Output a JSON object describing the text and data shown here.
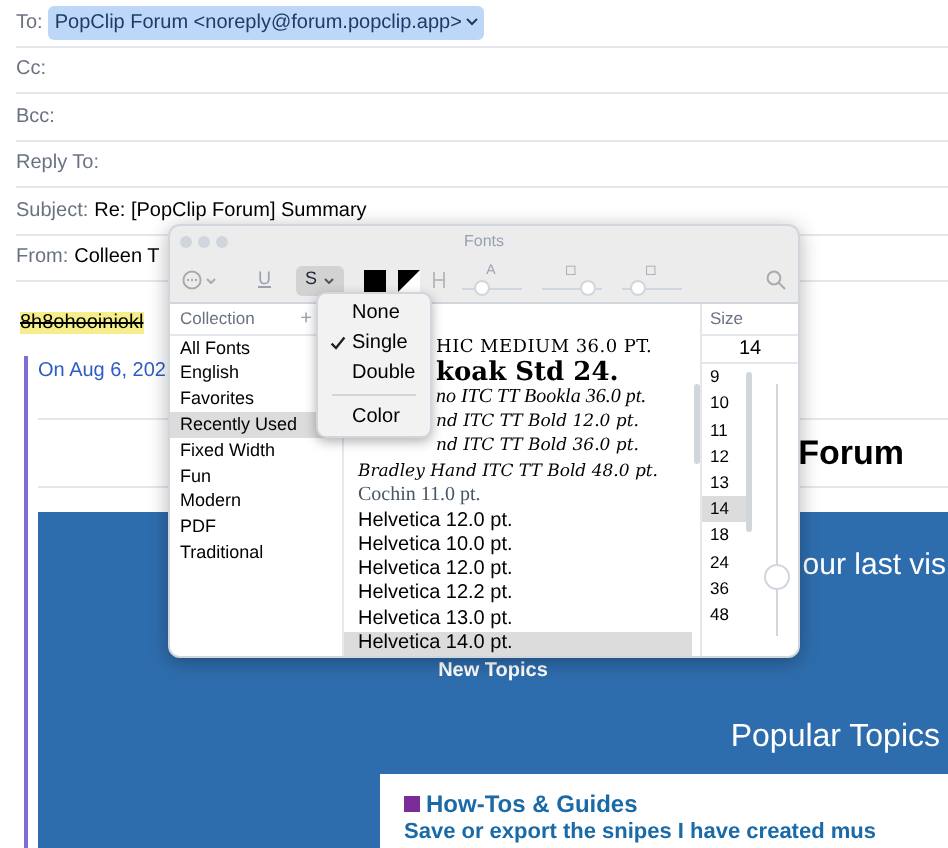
{
  "headers": [
    {
      "label": "To:",
      "value": "PopClip Forum <noreply@forum.popclip.app>",
      "kind": "chip"
    },
    {
      "label": "Cc:",
      "kind": "empty"
    },
    {
      "label": "Bcc:",
      "kind": "empty"
    },
    {
      "label": "Reply To:",
      "kind": "empty"
    },
    {
      "label": "Subject:",
      "value": "Re: [PopClip Forum] Summary",
      "kind": "text"
    },
    {
      "label": "From:",
      "value": "Colleen T",
      "kind": "text"
    }
  ],
  "body": {
    "struck_text": "8h8ohooiniokl",
    "quote_intro": "On Aug 6, 202",
    "forum_title": "Forum",
    "last_visit": "our last vis",
    "new_topics": "New Topics",
    "popular_topics": "Popular Topics",
    "category": "How-Tos & Guides",
    "topic_link": "Save or export the snipes I have created mus"
  },
  "fonts_window": {
    "title": "Fonts",
    "toolbar_sliders": [
      {
        "label": "A",
        "level": 0.3
      },
      {
        "label": "◻",
        "level": 0.9
      },
      {
        "label": "◻",
        "level": 0.2
      }
    ],
    "strike_button": {
      "label": "S",
      "pressed": true
    },
    "underline_button": {
      "label": "U"
    },
    "collection_header": "Collection",
    "add": "+",
    "collections": [
      {
        "label": "All Fonts",
        "selected": false
      },
      {
        "label": "English",
        "selected": false
      },
      {
        "label": "Favorites",
        "selected": false
      },
      {
        "label": "Recently Used",
        "selected": true
      },
      {
        "label": "Fixed Width",
        "selected": false
      },
      {
        "label": "Fun",
        "selected": false
      },
      {
        "label": "Modern",
        "selected": false
      },
      {
        "label": "PDF",
        "selected": false
      },
      {
        "label": "Traditional",
        "selected": false
      }
    ],
    "fonts": [
      {
        "label": "HIC MEDIUM 36.0 PT.",
        "kind": "caps",
        "covered": true,
        "selected": false
      },
      {
        "label": "koak Std 24.",
        "kind": "heavy",
        "covered": true,
        "selected": false
      },
      {
        "label": "no ITC TT Bookla 36.0 pt.",
        "kind": "italic",
        "covered": true,
        "selected": false
      },
      {
        "label": "nd ITC TT Bold 12.0 pt.",
        "kind": "script",
        "covered": true,
        "selected": false
      },
      {
        "label": "nd ITC TT Bold 36.0 pt.",
        "kind": "script",
        "covered": true,
        "selected": false
      },
      {
        "label": "Bradley Hand ITC TT Bold 48.0 pt.",
        "kind": "script",
        "covered": false,
        "selected": false
      },
      {
        "label": "Cochin 11.0 pt.",
        "kind": "serif",
        "covered": false,
        "selected": false
      },
      {
        "label": "Helvetica 12.0 pt.",
        "kind": "sans",
        "covered": false,
        "selected": false
      },
      {
        "label": "Helvetica 10.0 pt.",
        "kind": "sans",
        "covered": false,
        "selected": false
      },
      {
        "label": "Helvetica 12.0 pt.",
        "kind": "sans",
        "covered": false,
        "selected": false
      },
      {
        "label": "Helvetica 12.2 pt.",
        "kind": "sans",
        "covered": false,
        "selected": false
      },
      {
        "label": "Helvetica 13.0 pt.",
        "kind": "sans",
        "covered": false,
        "selected": false
      },
      {
        "label": "Helvetica 14.0 pt.",
        "kind": "sans",
        "covered": false,
        "selected": true
      }
    ],
    "size_header": "Size",
    "size_value": "14",
    "sizes": [
      {
        "label": "9",
        "selected": false
      },
      {
        "label": "10",
        "selected": false
      },
      {
        "label": "11",
        "selected": false
      },
      {
        "label": "12",
        "selected": false
      },
      {
        "label": "13",
        "selected": false
      },
      {
        "label": "14",
        "selected": true
      },
      {
        "label": "18",
        "selected": false
      },
      {
        "label": "24",
        "selected": false
      },
      {
        "label": "36",
        "selected": false
      },
      {
        "label": "48",
        "selected": false
      }
    ],
    "size_slider": {
      "level": 0.2
    }
  },
  "strike_menu": [
    {
      "label": "None",
      "kind": "item",
      "checked": false
    },
    {
      "label": "Single",
      "kind": "item",
      "checked": true
    },
    {
      "label": "Double",
      "kind": "item",
      "checked": false
    },
    {
      "kind": "separator"
    },
    {
      "label": "Color",
      "kind": "item",
      "checked": false
    }
  ]
}
